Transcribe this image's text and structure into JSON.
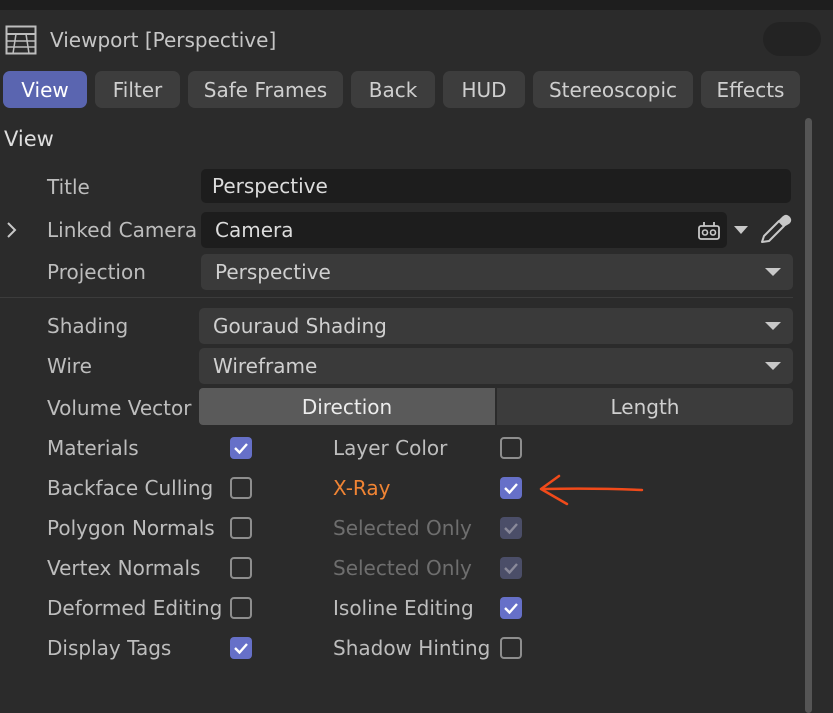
{
  "window": {
    "title": "Viewport [Perspective]"
  },
  "tabs": [
    {
      "label": "View",
      "active": true
    },
    {
      "label": "Filter",
      "active": false
    },
    {
      "label": "Safe Frames",
      "active": false
    },
    {
      "label": "Back",
      "active": false
    },
    {
      "label": "HUD",
      "active": false
    },
    {
      "label": "Stereoscopic",
      "active": false
    },
    {
      "label": "Effects",
      "active": false
    }
  ],
  "section": {
    "title": "View"
  },
  "fields": {
    "title": {
      "label": "Title",
      "value": "Perspective"
    },
    "linked_camera": {
      "label": "Linked Camera",
      "value": "Camera"
    },
    "projection": {
      "label": "Projection",
      "value": "Perspective"
    },
    "shading": {
      "label": "Shading",
      "value": "Gouraud Shading"
    },
    "wire": {
      "label": "Wire",
      "value": "Wireframe"
    },
    "volume_vector": {
      "label": "Volume Vector",
      "options": [
        "Direction",
        "Length"
      ],
      "selected": "Direction"
    }
  },
  "checkboxes_left": [
    {
      "label": "Materials",
      "checked": true
    },
    {
      "label": "Backface Culling",
      "checked": false
    },
    {
      "label": "Polygon Normals",
      "checked": false
    },
    {
      "label": "Vertex Normals",
      "checked": false
    },
    {
      "label": "Deformed Editing",
      "checked": false
    },
    {
      "label": "Display Tags",
      "checked": true
    }
  ],
  "checkboxes_right": [
    {
      "label": "Layer Color",
      "checked": false,
      "enabled": true
    },
    {
      "label": "X-Ray",
      "checked": true,
      "enabled": true,
      "highlight": "#f08434"
    },
    {
      "label": "Selected Only",
      "checked": true,
      "enabled": false
    },
    {
      "label": "Selected Only",
      "checked": true,
      "enabled": false
    },
    {
      "label": "Isoline Editing",
      "checked": true,
      "enabled": true
    },
    {
      "label": "Shadow Hinting",
      "checked": false,
      "enabled": true
    }
  ],
  "colors": {
    "accent": "#5a65b0",
    "checkbox_on": "#6670c8",
    "annotation": "#f04a1a"
  }
}
